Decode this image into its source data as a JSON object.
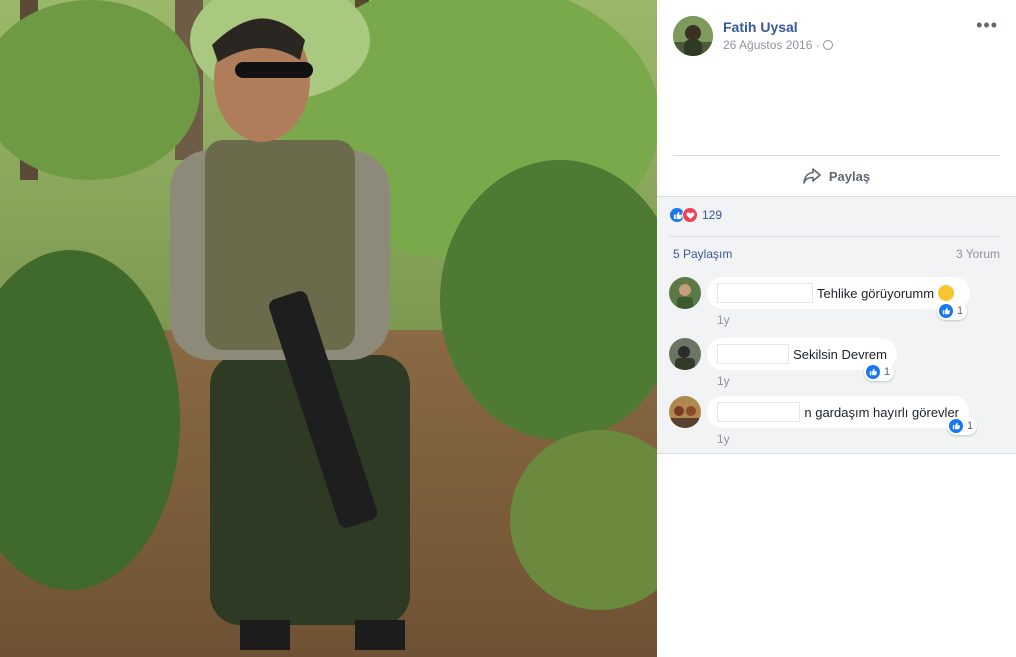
{
  "post": {
    "author": "Fatih Uysal",
    "date": "26 Ağustos 2016 ·",
    "more_icon": "more-options-icon",
    "privacy_icon": "globe-icon",
    "share_label": "Paylaş"
  },
  "stats": {
    "reaction_count": "129",
    "shares": "5 Paylaşım",
    "comments": "3 Yorum"
  },
  "comments": [
    {
      "text": "Tehlike görüyorumm",
      "likes": "1",
      "time": "1y",
      "emoji": "wink-emoji"
    },
    {
      "text": "Sekilsin Devrem",
      "likes": "1",
      "time": "1y"
    },
    {
      "text": "n gardaşım hayırlı görevler",
      "likes": "1",
      "time": "1y"
    }
  ],
  "colors": {
    "link": "#365899",
    "like_blue": "#1877f2",
    "love_red": "#f33e58",
    "secondary_text": "#90949c"
  }
}
